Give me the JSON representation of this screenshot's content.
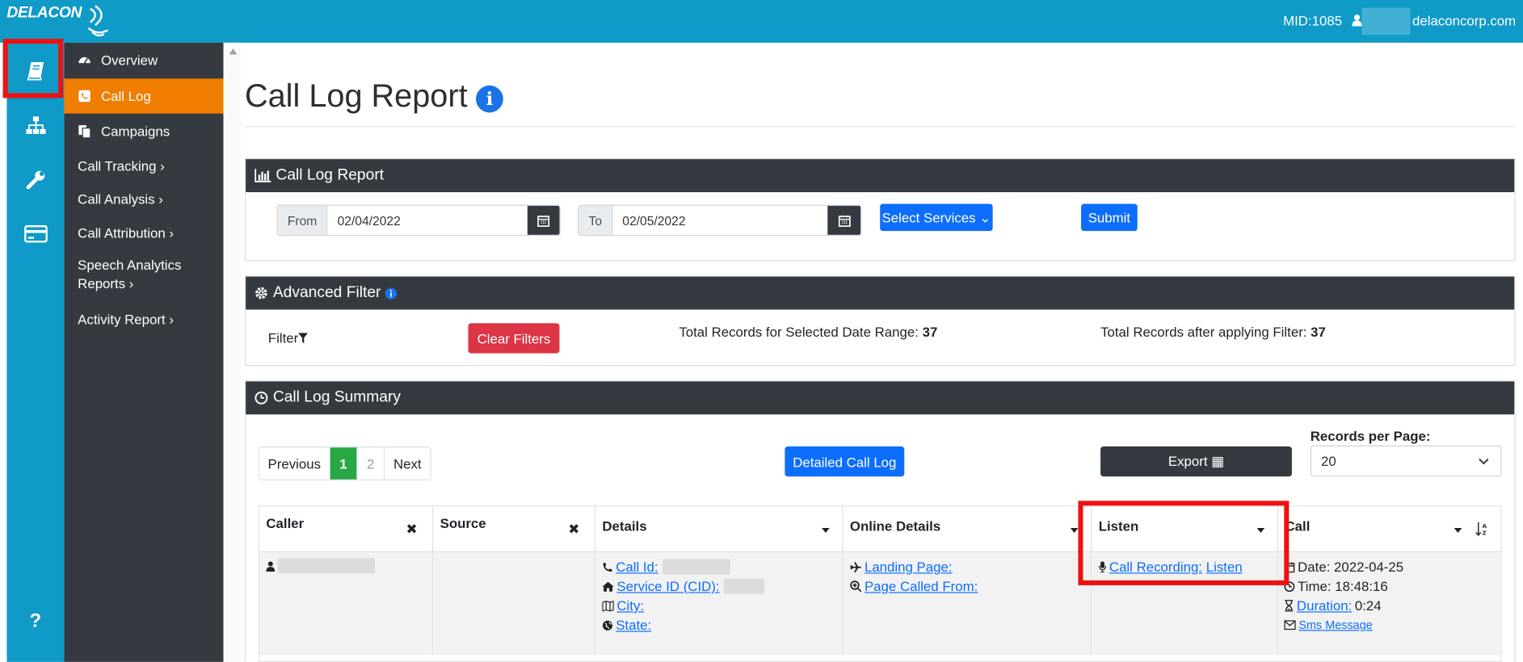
{
  "brand": {
    "logo_text": "DELACON"
  },
  "header": {
    "mid": "MID:1085",
    "email": "delaconcorp.com"
  },
  "rail": [
    {
      "icon": "book-icon"
    },
    {
      "icon": "sitemap-icon"
    },
    {
      "icon": "wrench-icon"
    },
    {
      "icon": "credit-card-icon"
    },
    {
      "icon": "help-icon",
      "label": "?"
    }
  ],
  "sidebar": {
    "items": [
      {
        "label": "Overview",
        "icon": "dashboard-icon"
      },
      {
        "label": "Call Log",
        "icon": "phone-square-icon",
        "active": true
      },
      {
        "label": "Campaigns",
        "icon": "copy-icon"
      },
      {
        "label": "Call Tracking ›"
      },
      {
        "label": "Call Analysis ›"
      },
      {
        "label": "Call Attribution ›"
      },
      {
        "label": "Speech Analytics",
        "label2": "Reports ›"
      },
      {
        "label": "Activity Report ›"
      }
    ]
  },
  "page": {
    "title": "Call Log Report"
  },
  "report_panel": {
    "title": "Call Log Report",
    "from_label": "From",
    "from_value": "02/04/2022",
    "to_label": "To",
    "to_value": "02/05/2022",
    "services_label": "Select Services ⌄",
    "submit_label": "Submit"
  },
  "filter_panel": {
    "title": "Advanced Filter",
    "filter_label": "Filter",
    "clear_label": "Clear Filters",
    "total_label": "Total Records for Selected Date Range:",
    "total_value": "37",
    "after_label": "Total Records after applying Filter:",
    "after_value": "37"
  },
  "summary_panel": {
    "title": "Call Log Summary",
    "pager": {
      "prev": "Previous",
      "pages": [
        "1",
        "2"
      ],
      "next": "Next"
    },
    "detailed_label": "Detailed Call Log",
    "export_label": "Export ▦",
    "records_label": "Records per Page:",
    "records_value": "20"
  },
  "table": {
    "headers": [
      "Caller",
      "Source",
      "Details",
      "Online Details",
      "Listen",
      "Call"
    ],
    "row": {
      "details": {
        "call_id": "Call Id:",
        "service_id": "Service ID (CID):",
        "city": "City:",
        "state": "State:"
      },
      "online": {
        "landing": "Landing Page:",
        "called_from": "Page Called From:"
      },
      "listen": {
        "recording": "Call Recording:",
        "listen": "Listen"
      },
      "call": {
        "date": "Date: 2022-04-25",
        "time": "Time: 18:48:16",
        "duration_label": "Duration:",
        "duration_value": "0:24",
        "sms": "Sms Message"
      }
    }
  }
}
